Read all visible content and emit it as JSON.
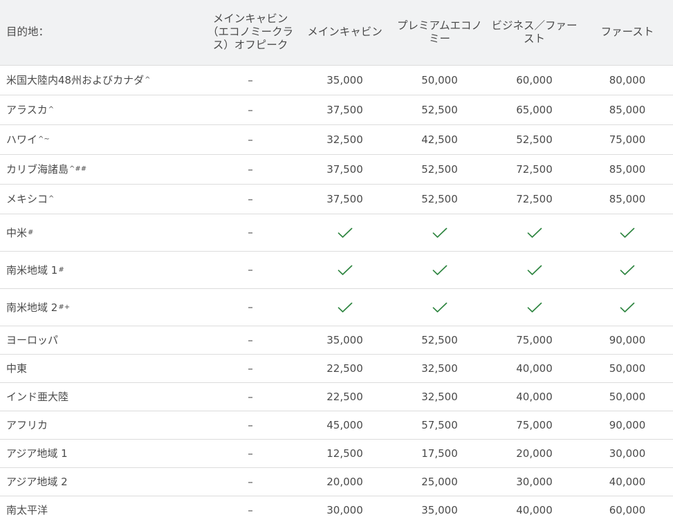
{
  "table": {
    "headers": {
      "destination": "目的地：",
      "main_offpeak": "メインキャビン（エコノミークラス）オフピーク",
      "main_cabin": "メインキャビン",
      "premium_economy": "プレミアムエコノミー",
      "business_first": "ビジネス／ファースト",
      "first": "ファースト"
    },
    "check_color": "#2e8540",
    "rows": [
      {
        "dest": "米国大陸内48州およびカナダ",
        "mark": "^",
        "offpeak": "–",
        "main": "35,000",
        "premium": "50,000",
        "business": "60,000",
        "first": "80,000",
        "check": false
      },
      {
        "dest": "アラスカ",
        "mark": "^",
        "offpeak": "–",
        "main": "37,500",
        "premium": "52,500",
        "business": "65,000",
        "first": "85,000",
        "check": false
      },
      {
        "dest": "ハワイ",
        "mark": "^~",
        "offpeak": "–",
        "main": "32,500",
        "premium": "42,500",
        "business": "52,500",
        "first": "75,000",
        "check": false
      },
      {
        "dest": "カリブ海諸島",
        "mark": "^##",
        "offpeak": "–",
        "main": "37,500",
        "premium": "52,500",
        "business": "72,500",
        "first": "85,000",
        "check": false
      },
      {
        "dest": "メキシコ",
        "mark": "^",
        "offpeak": "–",
        "main": "37,500",
        "premium": "52,500",
        "business": "72,500",
        "first": "85,000",
        "check": false
      },
      {
        "dest": "中米",
        "mark": "#",
        "offpeak": "–",
        "check": true
      },
      {
        "dest": "南米地域 1",
        "mark": "#",
        "offpeak": "–",
        "check": true
      },
      {
        "dest": "南米地域 2",
        "mark": "#+",
        "offpeak": "–",
        "check": true
      },
      {
        "dest": "ヨーロッパ",
        "mark": "",
        "offpeak": "–",
        "main": "35,000",
        "premium": "52,500",
        "business": "75,000",
        "first": "90,000",
        "check": false
      },
      {
        "dest": "中東",
        "mark": "",
        "offpeak": "–",
        "main": "22,500",
        "premium": "32,500",
        "business": "40,000",
        "first": "50,000",
        "check": false
      },
      {
        "dest": "インド亜大陸",
        "mark": "",
        "offpeak": "–",
        "main": "22,500",
        "premium": "32,500",
        "business": "40,000",
        "first": "50,000",
        "check": false
      },
      {
        "dest": "アフリカ",
        "mark": "",
        "offpeak": "–",
        "main": "45,000",
        "premium": "57,500",
        "business": "75,000",
        "first": "90,000",
        "check": false
      },
      {
        "dest": "アジア地域 1",
        "mark": "",
        "offpeak": "–",
        "main": "12,500",
        "premium": "17,500",
        "business": "20,000",
        "first": "30,000",
        "check": false
      },
      {
        "dest": "アジア地域 2",
        "mark": "",
        "offpeak": "–",
        "main": "20,000",
        "premium": "25,000",
        "business": "30,000",
        "first": "40,000",
        "check": false
      },
      {
        "dest": "南太平洋",
        "mark": "",
        "offpeak": "–",
        "main": "30,000",
        "premium": "35,000",
        "business": "40,000",
        "first": "60,000",
        "check": false
      }
    ]
  }
}
